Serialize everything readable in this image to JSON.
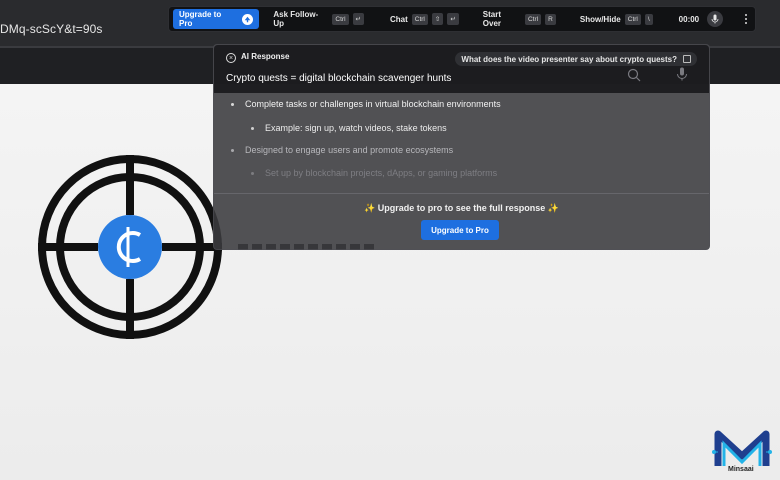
{
  "address_bar": {
    "url_fragment": "DMq-scScY&t=90s"
  },
  "toolbar": {
    "upgrade_label": "Upgrade to Pro",
    "ask_followup_label": "Ask Follow-Up",
    "ask_followup_keys": [
      "Ctrl",
      "↵"
    ],
    "chat_label": "Chat",
    "chat_keys": [
      "Ctrl",
      "⇧",
      "↵"
    ],
    "start_over_label": "Start Over",
    "start_over_keys": [
      "Ctrl",
      "R"
    ],
    "show_hide_label": "Show/Hide",
    "show_hide_keys": [
      "Ctrl",
      "\\"
    ],
    "timer": "00:00"
  },
  "ai_panel": {
    "label": "AI Response",
    "question": "What does the video presenter say about crypto quests?",
    "headline": "Crypto quests = digital blockchain scavenger hunts",
    "bullets": [
      "Complete tasks or challenges in virtual blockchain environments",
      "Example: sign up, watch videos, stake tokens",
      "Designed to engage users and promote ecosystems",
      "Set up by blockchain projects, dApps, or gaming platforms"
    ],
    "upgrade_message": "✨ Upgrade to pro to see the full response ✨",
    "upgrade_button": "Upgrade to Pro"
  },
  "watermark": {
    "brand": "Minsaai"
  },
  "colors": {
    "accent": "#1e6fe0",
    "crosshair_coin": "#2a7de1"
  }
}
